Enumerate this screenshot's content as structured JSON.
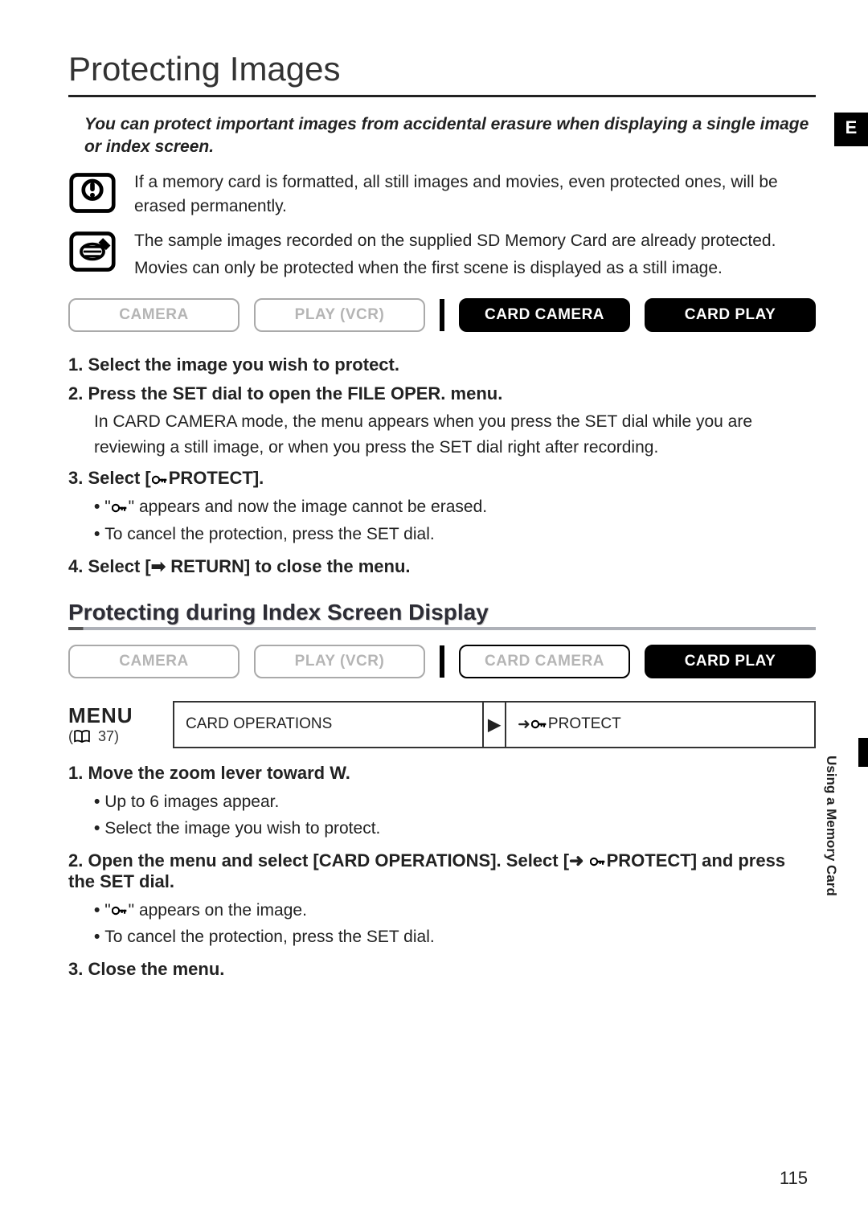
{
  "title": "Protecting Images",
  "side_label": "E",
  "intro": "You can protect important images from accidental erasure when displaying a single image or index screen.",
  "warning_text": "If a memory card is formatted, all still images and movies, even protected ones, will be erased permanently.",
  "notes": [
    "The sample images recorded on the supplied SD Memory Card are already protected.",
    "Movies can only be protected when the first scene is displayed as a still image."
  ],
  "modes_primary": {
    "camera": "CAMERA",
    "play_vcr": "PLAY (VCR)",
    "card_camera": "CARD CAMERA",
    "card_play": "CARD PLAY"
  },
  "steps_primary": {
    "s1": "1. Select the image you wish to protect.",
    "s2": "2. Press the SET dial to open the FILE OPER. menu.",
    "s2_body": "In CARD CAMERA mode, the menu appears when you press the SET dial while you are reviewing a still image, or when you press the SET dial right after recording.",
    "s3_pre": "3. Select [",
    "s3_post": "PROTECT].",
    "s3_b1_pre": "\"",
    "s3_b1_post": "\" appears and now the image cannot be erased.",
    "s3_b2": "To cancel the protection, press the SET dial.",
    "s4": "4. Select [➡ RETURN] to close the menu."
  },
  "subheading": "Protecting during Index Screen Display",
  "modes_secondary": {
    "camera": "CAMERA",
    "play_vcr": "PLAY (VCR)",
    "card_camera": "CARD CAMERA",
    "card_play": "CARD PLAY"
  },
  "menu": {
    "label": "MENU",
    "ref_pre": "(",
    "ref_num": " 37)",
    "left": "CARD OPERATIONS",
    "arrow": "▶",
    "right_pre": "➜ ",
    "right_post": "PROTECT"
  },
  "steps_secondary": {
    "s1": "1. Move the zoom lever toward W.",
    "s1_b1": "Up to 6 images appear.",
    "s1_b2": "Select the image you wish to protect.",
    "s2_pre": "2. Open the menu and select [CARD OPERATIONS]. Select [➜ ",
    "s2_post": "PROTECT] and press the SET dial.",
    "s2_b1_pre": "\"",
    "s2_b1_post": "\" appears on the image.",
    "s2_b2": "To cancel the protection, press the SET dial.",
    "s3": "3. Close the menu."
  },
  "side_section": "Using a Memory Card",
  "page_number": "115"
}
